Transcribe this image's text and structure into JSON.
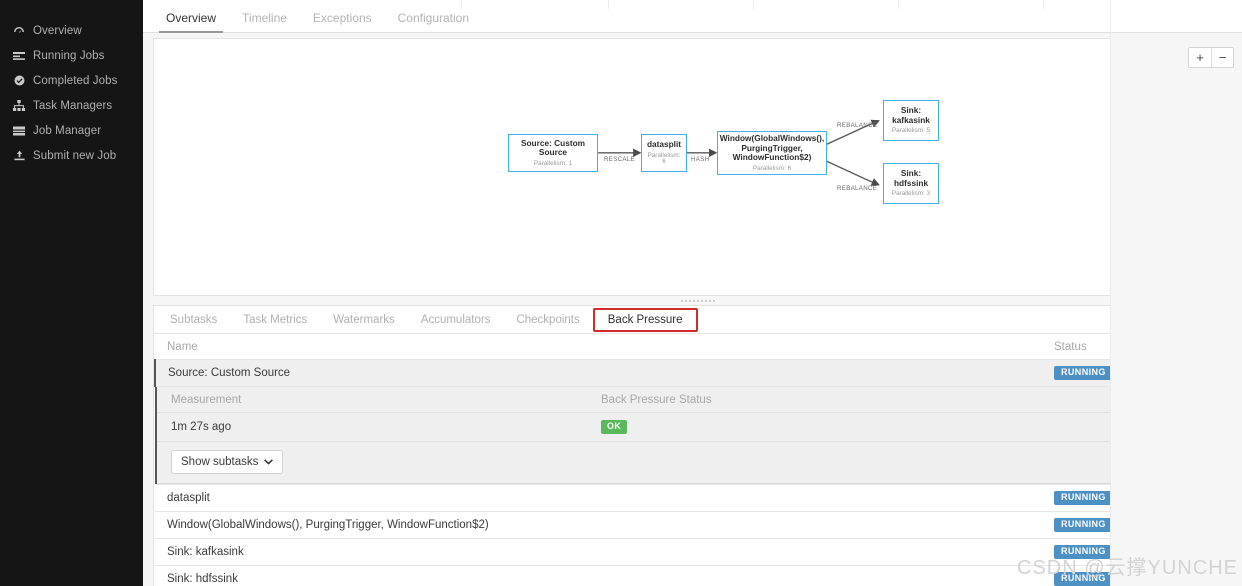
{
  "sidebar": {
    "items": [
      {
        "label": "Overview",
        "icon": "dashboard-icon"
      },
      {
        "label": "Running Jobs",
        "icon": "list-icon"
      },
      {
        "label": "Completed Jobs",
        "icon": "check-circle-icon"
      },
      {
        "label": "Task Managers",
        "icon": "sitemap-icon"
      },
      {
        "label": "Job Manager",
        "icon": "server-icon"
      },
      {
        "label": "Submit new Job",
        "icon": "upload-icon"
      }
    ]
  },
  "top_tabs": [
    {
      "label": "Overview",
      "active": true
    },
    {
      "label": "Timeline",
      "active": false
    },
    {
      "label": "Exceptions",
      "active": false
    },
    {
      "label": "Configuration",
      "active": false
    }
  ],
  "graph": {
    "zoom_in_label": "+",
    "zoom_out_label": "−",
    "nodes": [
      {
        "id": "source",
        "title": "Source: Custom Source",
        "parallelism": "Parallelism: 1"
      },
      {
        "id": "datasplit",
        "title": "datasplit",
        "parallelism": "Parallelism: 6"
      },
      {
        "id": "window",
        "title": "Window(GlobalWindows(), PurgingTrigger, WindowFunction$2)",
        "parallelism": "Parallelism: 6"
      },
      {
        "id": "kafkasink",
        "title": "Sink: kafkasink",
        "parallelism": "Parallelism: 5"
      },
      {
        "id": "hdfssink",
        "title": "Sink: hdfssink",
        "parallelism": "Parallelism: 3"
      }
    ],
    "edges": [
      {
        "label": "RESCALE"
      },
      {
        "label": "HASH"
      },
      {
        "label": "REBALANCE"
      },
      {
        "label": "REBALANCE"
      }
    ]
  },
  "bottom_tabs": [
    {
      "label": "Subtasks",
      "active": false
    },
    {
      "label": "Task Metrics",
      "active": false
    },
    {
      "label": "Watermarks",
      "active": false
    },
    {
      "label": "Accumulators",
      "active": false
    },
    {
      "label": "Checkpoints",
      "active": false
    },
    {
      "label": "Back Pressure",
      "active": true
    }
  ],
  "table": {
    "columns": {
      "name": "Name",
      "status": "Status"
    },
    "rows": [
      {
        "name": "Source: Custom Source",
        "status": "RUNNING",
        "expanded": true
      },
      {
        "name": "datasplit",
        "status": "RUNNING",
        "expanded": false
      },
      {
        "name": "Window(GlobalWindows(), PurgingTrigger, WindowFunction$2)",
        "status": "RUNNING",
        "expanded": false
      },
      {
        "name": "Sink: kafkasink",
        "status": "RUNNING",
        "expanded": false
      },
      {
        "name": "Sink: hdfssink",
        "status": "RUNNING",
        "expanded": false
      }
    ],
    "detail": {
      "columns": {
        "measurement": "Measurement",
        "back_pressure": "Back Pressure Status"
      },
      "measurement_value": "1m 27s ago",
      "back_pressure_value": "OK",
      "show_subtasks_label": "Show subtasks"
    }
  },
  "watermark": "CSDN @云撑YUNCHE",
  "colors": {
    "node_border": "#3fb1e3",
    "running_badge": "#4d90c4",
    "ok_badge": "#5cb85c",
    "active_tab_outline": "#cf2b2b",
    "sidebar_bg": "#151515"
  }
}
